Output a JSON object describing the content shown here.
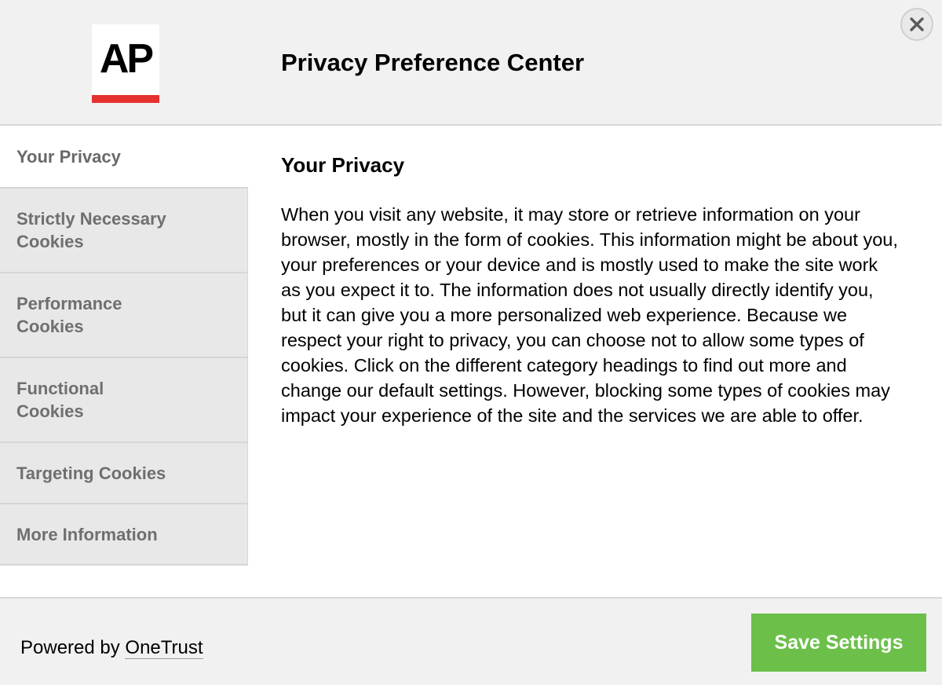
{
  "header": {
    "logo_text": "AP",
    "title": "Privacy Preference Center",
    "close_icon": "close-icon"
  },
  "sidebar": {
    "tabs": [
      {
        "label_lines": [
          "Your Privacy"
        ],
        "active": true
      },
      {
        "label_lines": [
          "Strictly Necessary",
          "Cookies"
        ],
        "active": false
      },
      {
        "label_lines": [
          "Performance",
          "Cookies"
        ],
        "active": false
      },
      {
        "label_lines": [
          "Functional",
          "Cookies"
        ],
        "active": false
      },
      {
        "label_lines": [
          "Targeting Cookies"
        ],
        "active": false
      },
      {
        "label_lines": [
          "More Information"
        ],
        "active": false
      }
    ]
  },
  "main": {
    "title": "Your Privacy",
    "body": "When you visit any website, it may store or retrieve information on your browser, mostly in the form of cookies. This information might be about you, your preferences or your device and is mostly used to make the site work as you expect it to. The information does not usually directly identify you, but it can give you a more personalized web experience. Because we respect your right to privacy, you can choose not to allow some types of cookies. Click on the different category headings to find out more and change our default settings. However, blocking some types of cookies may impact your experience of the site and the services we are able to offer."
  },
  "footer": {
    "powered_prefix": "Powered by ",
    "powered_link": "OneTrust",
    "save_label": "Save Settings"
  },
  "colors": {
    "accent_green": "#6cc04a",
    "logo_red": "#e5312f",
    "header_bg": "#f1f1f1",
    "tab_bg": "#e8e8e8"
  }
}
